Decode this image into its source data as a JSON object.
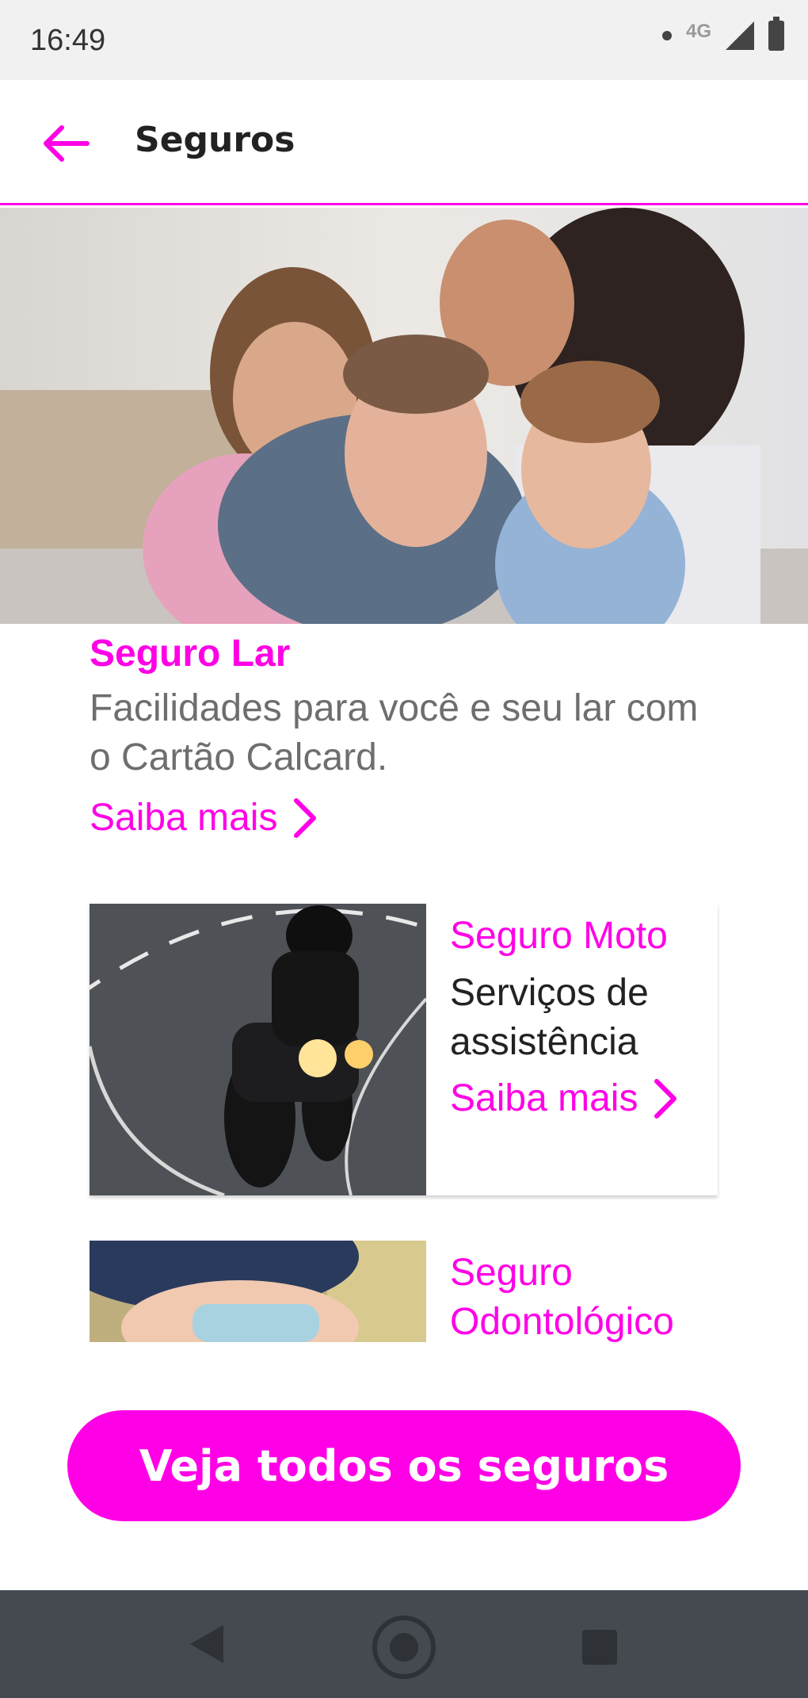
{
  "status_bar": {
    "time": "16:49",
    "network": "4G"
  },
  "header": {
    "title": "Seguros"
  },
  "featured": {
    "title": "Seguro Lar",
    "description": "Facilidades para você e seu lar com o Cartão Calcard.",
    "link_label": "Saiba mais"
  },
  "cards": [
    {
      "title": "Seguro Moto",
      "description": "Serviços de assistência",
      "link_label": "Saiba mais"
    },
    {
      "title": "Seguro Odontológico"
    }
  ],
  "cta": {
    "label": "Veja todos os seguros"
  },
  "colors": {
    "accent": "#ff00e6",
    "navbar": "#454a51"
  }
}
